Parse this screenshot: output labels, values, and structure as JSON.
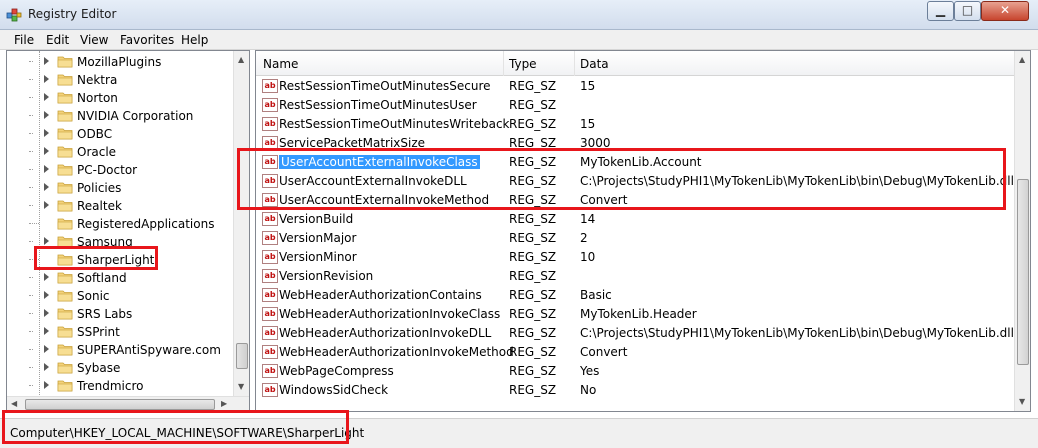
{
  "window": {
    "title": "Registry Editor",
    "minimize_label": "▁",
    "maximize_label": "□",
    "close_label": "✕"
  },
  "menu": [
    {
      "first": "F",
      "rest": "ile"
    },
    {
      "first": "E",
      "rest": "dit"
    },
    {
      "first": "V",
      "rest": "iew"
    },
    {
      "first": "",
      "rest": "Favorites",
      "mid": "a"
    },
    {
      "first": "H",
      "rest": "elp"
    }
  ],
  "menu_labels": [
    "File",
    "Edit",
    "View",
    "Favorites",
    "Help"
  ],
  "tree": {
    "items": [
      {
        "label": "MozillaPlugins",
        "expandable": true
      },
      {
        "label": "Nektra",
        "expandable": true
      },
      {
        "label": "Norton",
        "expandable": true
      },
      {
        "label": "NVIDIA Corporation",
        "expandable": true
      },
      {
        "label": "ODBC",
        "expandable": true
      },
      {
        "label": "Oracle",
        "expandable": true
      },
      {
        "label": "PC-Doctor",
        "expandable": true
      },
      {
        "label": "Policies",
        "expandable": true
      },
      {
        "label": "Realtek",
        "expandable": true
      },
      {
        "label": "RegisteredApplications",
        "expandable": false
      },
      {
        "label": "Samsung",
        "expandable": true
      },
      {
        "label": "SharperLight",
        "expandable": false,
        "selected": true
      },
      {
        "label": "Softland",
        "expandable": true
      },
      {
        "label": "Sonic",
        "expandable": true
      },
      {
        "label": "SRS Labs",
        "expandable": true
      },
      {
        "label": "SSPrint",
        "expandable": true
      },
      {
        "label": "SUPERAntiSpyware.com",
        "expandable": true
      },
      {
        "label": "Sybase",
        "expandable": true
      },
      {
        "label": "Trendmicro",
        "expandable": true
      }
    ]
  },
  "list": {
    "columns": {
      "name": "Name",
      "type": "Type",
      "data": "Data"
    },
    "rows": [
      {
        "name": "RestSessionTimeOutMinutesSecure",
        "type": "REG_SZ",
        "data": "15"
      },
      {
        "name": "RestSessionTimeOutMinutesUser",
        "type": "REG_SZ",
        "data": ""
      },
      {
        "name": "RestSessionTimeOutMinutesWriteback",
        "type": "REG_SZ",
        "data": "15"
      },
      {
        "name": "ServicePacketMatrixSize",
        "type": "REG_SZ",
        "data": "3000"
      },
      {
        "name": "UserAccountExternalInvokeClass",
        "type": "REG_SZ",
        "data": "MyTokenLib.Account",
        "selected": true
      },
      {
        "name": "UserAccountExternalInvokeDLL",
        "type": "REG_SZ",
        "data": "C:\\Projects\\StudyPHI1\\MyTokenLib\\MyTokenLib\\bin\\Debug\\MyTokenLib.dll"
      },
      {
        "name": "UserAccountExternalInvokeMethod",
        "type": "REG_SZ",
        "data": "Convert"
      },
      {
        "name": "VersionBuild",
        "type": "REG_SZ",
        "data": "14"
      },
      {
        "name": "VersionMajor",
        "type": "REG_SZ",
        "data": "2"
      },
      {
        "name": "VersionMinor",
        "type": "REG_SZ",
        "data": "10"
      },
      {
        "name": "VersionRevision",
        "type": "REG_SZ",
        "data": ""
      },
      {
        "name": "WebHeaderAuthorizationContains",
        "type": "REG_SZ",
        "data": "Basic"
      },
      {
        "name": "WebHeaderAuthorizationInvokeClass",
        "type": "REG_SZ",
        "data": "MyTokenLib.Header"
      },
      {
        "name": "WebHeaderAuthorizationInvokeDLL",
        "type": "REG_SZ",
        "data": "C:\\Projects\\StudyPHI1\\MyTokenLib\\MyTokenLib\\bin\\Debug\\MyTokenLib.dll"
      },
      {
        "name": "WebHeaderAuthorizationInvokeMethod",
        "type": "REG_SZ",
        "data": "Convert"
      },
      {
        "name": "WebPageCompress",
        "type": "REG_SZ",
        "data": "Yes"
      },
      {
        "name": "WindowsSidCheck",
        "type": "REG_SZ",
        "data": "No"
      }
    ]
  },
  "value_icon_text": "ab",
  "status": {
    "path": "Computer\\HKEY_LOCAL_MACHINE\\SOFTWARE\\SharperLight"
  },
  "colors": {
    "highlight_red": "#e8161b",
    "selection_blue": "#3399ff"
  }
}
